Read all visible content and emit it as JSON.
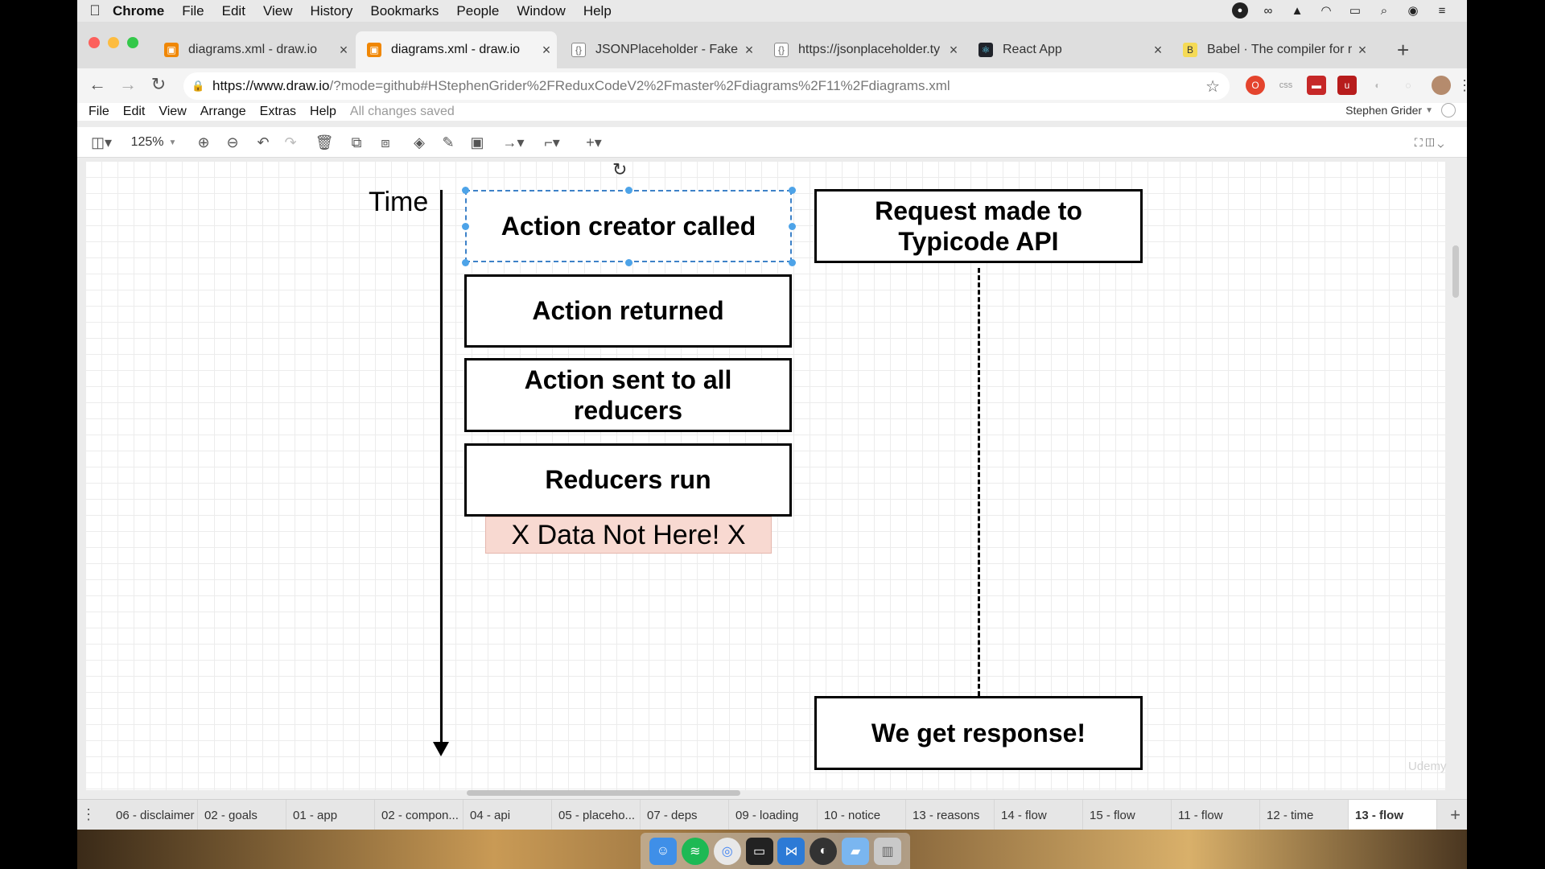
{
  "mac_menubar": {
    "apple": "",
    "items": [
      "Chrome",
      "File",
      "Edit",
      "View",
      "History",
      "Bookmarks",
      "People",
      "Window",
      "Help"
    ]
  },
  "browser": {
    "tabs": [
      {
        "title": "diagrams.xml - draw.io",
        "favicon": "drawio-icon",
        "color": "#f08705"
      },
      {
        "title": "diagrams.xml - draw.io",
        "favicon": "drawio-icon",
        "color": "#f08705"
      },
      {
        "title": "JSONPlaceholder - Fake o",
        "favicon": "json-icon",
        "color": "#666666"
      },
      {
        "title": "https://jsonplaceholder.ty",
        "favicon": "json-icon",
        "color": "#666666"
      },
      {
        "title": "React App",
        "favicon": "react-icon",
        "color": "#20232a"
      },
      {
        "title": "Babel · The compiler for n",
        "favicon": "babel-icon",
        "color": "#f5da55"
      }
    ],
    "url_host": "https://www.draw.io",
    "url_rest": "/?mode=github#HStephenGrider%2FReduxCodeV2%2Fmaster%2Fdiagrams%2F11%2Fdiagrams.xml"
  },
  "drawio": {
    "menu": [
      "File",
      "Edit",
      "View",
      "Arrange",
      "Extras",
      "Help"
    ],
    "status": "All changes saved",
    "user": "Stephen Grider",
    "zoom": "125%"
  },
  "diagram": {
    "time_label": "Time",
    "boxes": {
      "action_creator": "Action creator called",
      "action_returned": "Action returned",
      "action_sent": "Action sent to all reducers",
      "reducers_run": "Reducers run",
      "request": "Request made to Typicode API",
      "response": "We get response!"
    },
    "warning": "X Data Not Here! X",
    "colors": {
      "selection": "#3e82c8",
      "warning_fill": "#f8d9d1"
    }
  },
  "page_tabs": [
    "06 - disclaimer",
    "02 - goals",
    "01 - app",
    "02 - compon...",
    "04 - api",
    "05 - placeho...",
    "07 - deps",
    "09 - loading",
    "10 - notice",
    "13 - reasons",
    "14 - flow",
    "15 - flow",
    "11 - flow",
    "12 - time",
    "13 - flow"
  ],
  "active_page": "13 - flow"
}
